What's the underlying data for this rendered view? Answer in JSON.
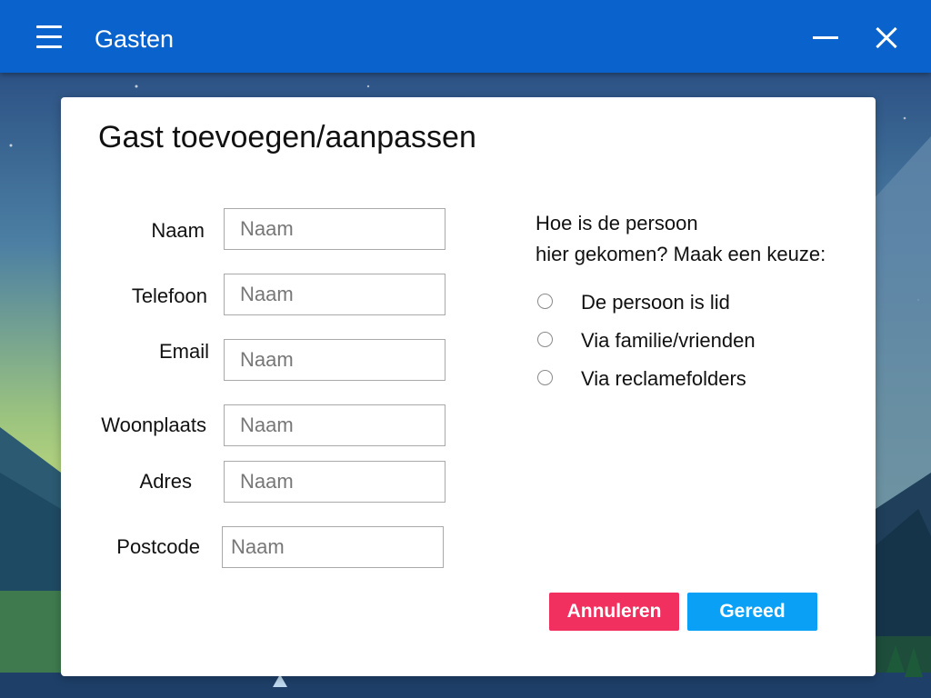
{
  "app": {
    "title": "Gasten"
  },
  "dialog": {
    "title": "Gast toevoegen/aanpassen",
    "fields": [
      {
        "label": "Naam",
        "placeholder": "Naam",
        "value": ""
      },
      {
        "label": "Telefoon",
        "placeholder": "Naam",
        "value": ""
      },
      {
        "label": "Email",
        "placeholder": "Naam",
        "value": ""
      },
      {
        "label": "Woonplaats",
        "placeholder": "Naam",
        "value": ""
      },
      {
        "label": "Adres",
        "placeholder": "Naam",
        "value": ""
      },
      {
        "label": "Postcode",
        "placeholder": "Naam",
        "value": ""
      }
    ],
    "question": {
      "line1": "Hoe is de persoon",
      "line2": "hier gekomen? Maak een keuze:"
    },
    "options": [
      {
        "label": "De persoon is lid",
        "selected": false
      },
      {
        "label": "Via familie/vrienden",
        "selected": false
      },
      {
        "label": "Via reclamefolders",
        "selected": false
      }
    ],
    "buttons": {
      "cancel": "Annuleren",
      "done": "Gereed"
    }
  },
  "colors": {
    "titlebar": "#0a63cc",
    "cancel_button": "#f2305f",
    "done_button": "#0aa0f5",
    "background_sky": "#2e5c8c",
    "background_glow": "#c9e07a"
  },
  "icons": {
    "menu": "hamburger-menu-icon",
    "minimize": "minimize-icon",
    "close": "close-icon",
    "radio": "radio-unchecked-icon"
  }
}
